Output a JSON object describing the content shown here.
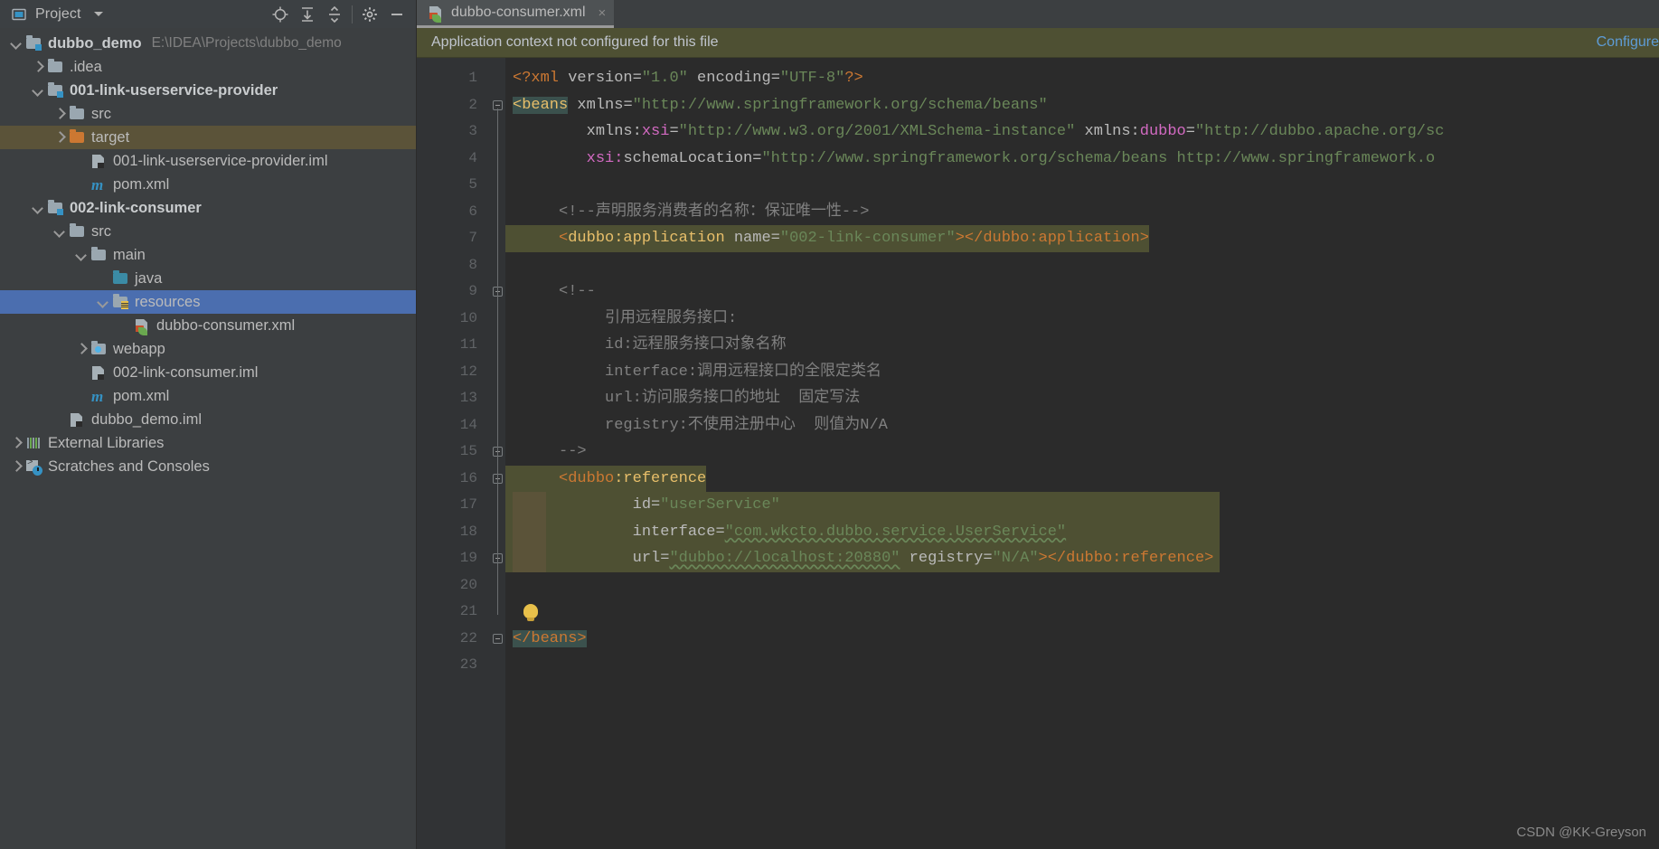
{
  "toolwindow": {
    "title": "Project",
    "icons": [
      "project-view-icon",
      "chevron-down-icon",
      "locate-icon",
      "expand-all-icon",
      "collapse-all-icon",
      "settings-icon",
      "minimize-icon"
    ]
  },
  "tree": [
    {
      "label": "dubbo_demo",
      "path": "E:\\IDEA\\Projects\\dubbo_demo",
      "indent": 0,
      "arrow": "down",
      "icon": "module-folder",
      "bold": true,
      "state": "normal"
    },
    {
      "label": ".idea",
      "path": "",
      "indent": 1,
      "arrow": "right",
      "icon": "folder-gray",
      "bold": false,
      "state": "normal"
    },
    {
      "label": "001-link-userservice-provider",
      "path": "",
      "indent": 1,
      "arrow": "down",
      "icon": "module-folder",
      "bold": true,
      "state": "normal"
    },
    {
      "label": "src",
      "path": "",
      "indent": 2,
      "arrow": "right",
      "icon": "folder-gray",
      "bold": false,
      "state": "normal"
    },
    {
      "label": "target",
      "path": "",
      "indent": 2,
      "arrow": "right",
      "icon": "folder-orange",
      "bold": false,
      "state": "hover"
    },
    {
      "label": "001-link-userservice-provider.iml",
      "path": "",
      "indent": 3,
      "arrow": "none",
      "icon": "iml-file",
      "bold": false,
      "state": "normal"
    },
    {
      "label": "pom.xml",
      "path": "",
      "indent": 3,
      "arrow": "none",
      "icon": "maven-file",
      "bold": false,
      "state": "normal"
    },
    {
      "label": "002-link-consumer",
      "path": "",
      "indent": 1,
      "arrow": "down",
      "icon": "module-folder",
      "bold": true,
      "state": "normal"
    },
    {
      "label": "src",
      "path": "",
      "indent": 2,
      "arrow": "down",
      "icon": "folder-gray",
      "bold": false,
      "state": "normal"
    },
    {
      "label": "main",
      "path": "",
      "indent": 3,
      "arrow": "down",
      "icon": "folder-gray",
      "bold": false,
      "state": "normal"
    },
    {
      "label": "java",
      "path": "",
      "indent": 4,
      "arrow": "none",
      "icon": "folder-teal",
      "bold": false,
      "state": "normal"
    },
    {
      "label": "resources",
      "path": "",
      "indent": 4,
      "arrow": "down",
      "icon": "folder-resources",
      "bold": false,
      "state": "selected"
    },
    {
      "label": "dubbo-consumer.xml",
      "path": "",
      "indent": 5,
      "arrow": "none",
      "icon": "spring-xml-file",
      "bold": false,
      "state": "normal"
    },
    {
      "label": "webapp",
      "path": "",
      "indent": 3,
      "arrow": "right",
      "icon": "folder-webapp",
      "bold": false,
      "state": "normal"
    },
    {
      "label": "002-link-consumer.iml",
      "path": "",
      "indent": 3,
      "arrow": "none",
      "icon": "iml-file",
      "bold": false,
      "state": "normal"
    },
    {
      "label": "pom.xml",
      "path": "",
      "indent": 3,
      "arrow": "none",
      "icon": "maven-file",
      "bold": false,
      "state": "normal"
    },
    {
      "label": "dubbo_demo.iml",
      "path": "",
      "indent": 2,
      "arrow": "none",
      "icon": "iml-file",
      "bold": false,
      "state": "normal"
    },
    {
      "label": "External Libraries",
      "path": "",
      "indent": 0,
      "arrow": "right",
      "icon": "libraries",
      "bold": false,
      "state": "normal"
    },
    {
      "label": "Scratches and Consoles",
      "path": "",
      "indent": 0,
      "arrow": "right",
      "icon": "scratches",
      "bold": false,
      "state": "normal"
    }
  ],
  "editor": {
    "tab": {
      "label": "dubbo-consumer.xml",
      "close": "×",
      "icon": "spring-xml-file"
    },
    "notification": {
      "message": "Application context not configured for this file",
      "action": "Configure"
    },
    "watermark": "CSDN @KK-Greyson",
    "lines": [
      {
        "n": "1"
      },
      {
        "n": "2"
      },
      {
        "n": "3"
      },
      {
        "n": "4"
      },
      {
        "n": "5"
      },
      {
        "n": "6"
      },
      {
        "n": "7"
      },
      {
        "n": "8"
      },
      {
        "n": "9"
      },
      {
        "n": "10"
      },
      {
        "n": "11"
      },
      {
        "n": "12"
      },
      {
        "n": "13"
      },
      {
        "n": "14"
      },
      {
        "n": "15"
      },
      {
        "n": "16"
      },
      {
        "n": "17"
      },
      {
        "n": "18"
      },
      {
        "n": "19"
      },
      {
        "n": "20"
      },
      {
        "n": "21"
      },
      {
        "n": "22"
      },
      {
        "n": "23"
      }
    ],
    "code": {
      "l1_decl_open": "<?xml ",
      "l1_attr1": "version",
      "l1_eq": "=",
      "l1_val1": "\"1.0\"",
      "l1_attr2": " encoding",
      "l1_val2": "\"UTF-8\"",
      "l1_decl_close": "?>",
      "l2_tag": "<beans",
      "l2_attr": " xmlns",
      "l2_val": "\"http://www.springframework.org/schema/beans\"",
      "l3_attr_ns": "xmlns:",
      "l3_attr_nm": "xsi",
      "l3_val": "\"http://www.w3.org/2001/XMLSchema-instance\"",
      "l3_attr2_ns": " xmlns:",
      "l3_attr2_nm": "dubbo",
      "l3_val2": "\"http://dubbo.apache.org/sc",
      "l4_attr_ns": "xsi:",
      "l4_attr_nm": "schemaLocation",
      "l4_val": "\"http://www.springframework.org/schema/beans http://www.springframework.o",
      "l6_comment": "<!--声明服务消费者的名称：保证唯一性-->",
      "l7_tag_open": "<dubbo:application",
      "l7_attr": " name",
      "l7_val": "\"002-link-consumer\"",
      "l7_tag_close": "></dubbo:application>",
      "l9_comment": "<!--",
      "l10_comment": "引用远程服务接口:",
      "l11_comment": "id:远程服务接口对象名称",
      "l12_comment": "interface:调用远程接口的全限定类名",
      "l13_comment": "url:访问服务接口的地址  固定写法",
      "l14_comment": "registry:不使用注册中心  则值为N/A",
      "l15_comment": "-->",
      "l16_tag": "<dubbo:reference",
      "l17_attr": "id",
      "l17_val": "\"userService\"",
      "l18_attr": "interface",
      "l18_val": "\"com.wkcto.dubbo.service.UserService\"",
      "l19_attr": "url",
      "l19_val": "\"dubbo://localhost:20880\"",
      "l19_attr2": " registry",
      "l19_val2": "\"N/A\"",
      "l19_close": "></dubbo:reference>",
      "l22_tag": "</beans>"
    }
  },
  "colors": {
    "bg_editor": "#2b2b2b",
    "bg_panel": "#3c3f41",
    "selection_blue": "#4b6eaf",
    "warn_olive": "#4e5033",
    "hover_brown": "#5b5339",
    "tag_yellow": "#e8bf6a",
    "tag_orange": "#cc7832",
    "string_green": "#6a8759",
    "comment_gray": "#808080",
    "link_blue": "#5e9cd6"
  }
}
